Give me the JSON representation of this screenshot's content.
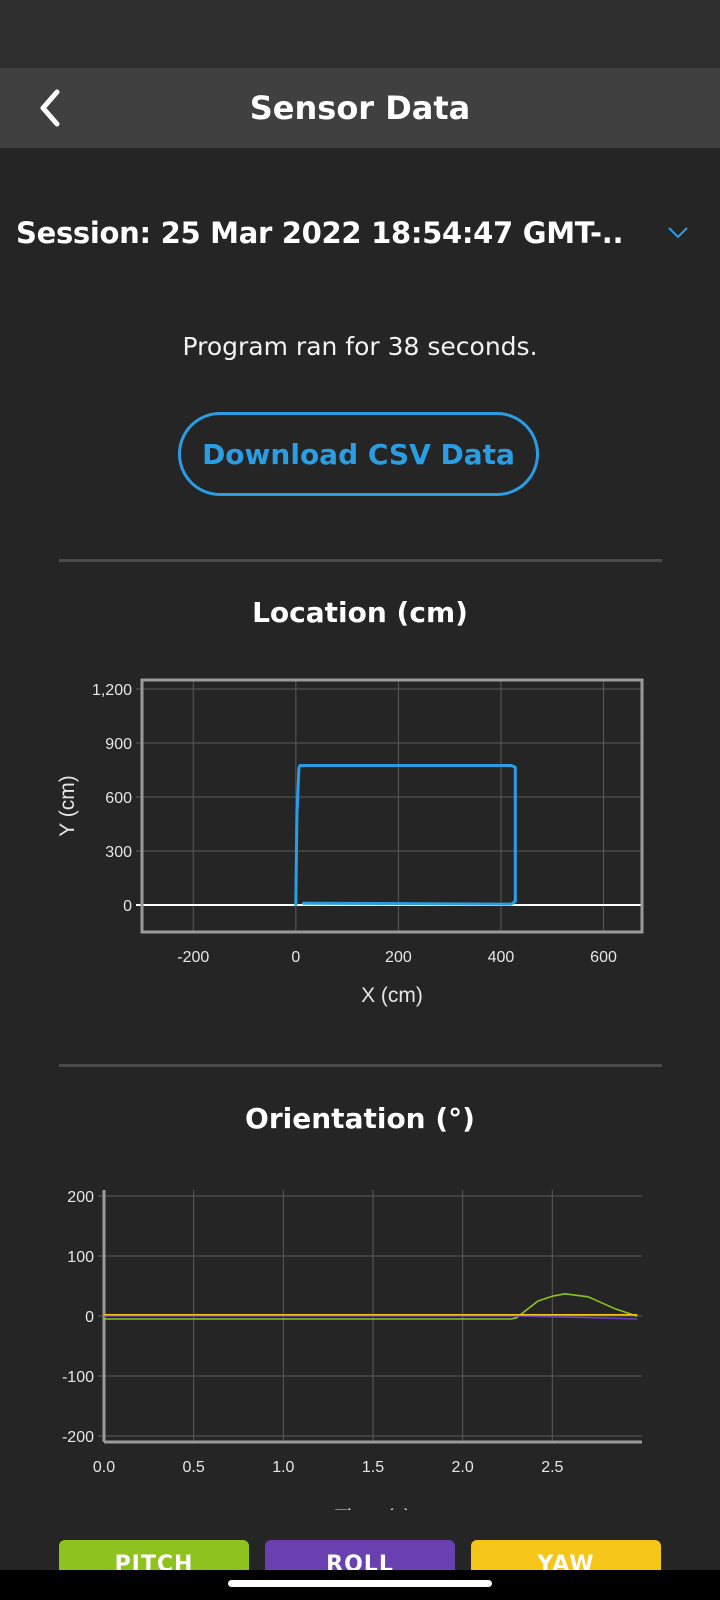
{
  "header": {
    "title": "Sensor Data",
    "back_icon": "chevron-left-icon"
  },
  "session": {
    "label": "Session: 25 Mar 2022 18:54:47 GMT-..",
    "dropdown_icon": "chevron-down-icon"
  },
  "run_info": "Program ran for 38 seconds.",
  "download_label": "Download CSV Data",
  "location": {
    "title": "Location (cm)"
  },
  "orientation": {
    "title": "Orientation (°)"
  },
  "legend": [
    {
      "label": "PITCH",
      "color": "#8dc21f"
    },
    {
      "label": "ROLL",
      "color": "#6a3fb0"
    },
    {
      "label": "YAW",
      "color": "#f5c518"
    }
  ],
  "colors": {
    "accent": "#2a9ee4",
    "background": "#252525",
    "header": "#404040"
  },
  "chart_data": [
    {
      "type": "line",
      "title": "Location (cm)",
      "xlabel": "X (cm)",
      "ylabel": "Y (cm)",
      "xlim": [
        -300,
        675
      ],
      "ylim": [
        -150,
        1250
      ],
      "xticks": [
        -200,
        0,
        200,
        400,
        600
      ],
      "xtick_labels": [
        "-200",
        "0",
        "200",
        "400",
        "600"
      ],
      "yticks": [
        0,
        300,
        600,
        900,
        1200
      ],
      "ytick_labels": [
        "0",
        "300",
        "600",
        "900",
        "1,200"
      ],
      "grid": true,
      "series": [
        {
          "color": "#2a9ee4",
          "x": [
            0,
            2,
            6,
            8,
            420,
            428,
            428,
            420,
            400,
            15
          ],
          "y": [
            0,
            500,
            760,
            775,
            775,
            765,
            20,
            5,
            5,
            10
          ]
        }
      ]
    },
    {
      "type": "line",
      "title": "Orientation (°)",
      "xlabel": "Time (s)",
      "ylabel": "",
      "xlim": [
        0,
        3.0
      ],
      "ylim": [
        -210,
        210
      ],
      "xticks": [
        0,
        0.5,
        1.0,
        1.5,
        2.0,
        2.5
      ],
      "xtick_labels": [
        "0.0",
        "0.5",
        "1.0",
        "1.5",
        "2.0",
        "2.5"
      ],
      "yticks": [
        -200,
        -100,
        0,
        100,
        200
      ],
      "ytick_labels": [
        "-200",
        "-100",
        "0",
        "100",
        "200"
      ],
      "grid": true,
      "series": [
        {
          "name": "PITCH",
          "color": "#8dc21f",
          "x": [
            0,
            2.27,
            2.3,
            2.42,
            2.5,
            2.57,
            2.7,
            2.85,
            2.97
          ],
          "y": [
            -5,
            -5,
            -3,
            25,
            33,
            37,
            32,
            12,
            0
          ]
        },
        {
          "name": "ROLL",
          "color": "#6a3fb0",
          "x": [
            0,
            2.3,
            2.6,
            2.97
          ],
          "y": [
            0,
            0,
            -2,
            -5
          ]
        },
        {
          "name": "YAW",
          "color": "#f5c518",
          "x": [
            0,
            2.97
          ],
          "y": [
            2,
            2
          ]
        }
      ]
    }
  ]
}
